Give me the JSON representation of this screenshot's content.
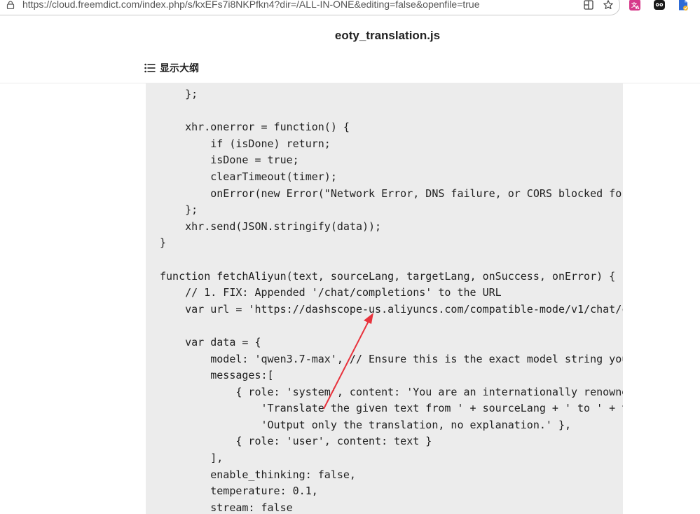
{
  "browser": {
    "url": "https://cloud.freemdict.com/index.php/s/kxEFs7i8NKPfkn4?dir=/ALL-IN-ONE&editing=false&openfile=true",
    "icons": [
      "lock-icon",
      "split-view-icon",
      "favorite-star-icon",
      "translate-extension-icon",
      "ghost-extension-icon",
      "bookmark-extension-icon"
    ],
    "accent_colors": {
      "translate": "#d63a8a",
      "bookmark": "#2e6bd6",
      "arrow": "#e8323c"
    }
  },
  "header": {
    "file_title": "eoty_translation.js",
    "outline_label": "显示大纲"
  },
  "code": {
    "lines": [
      "    };",
      "",
      "    xhr.onerror = function() {",
      "        if (isDone) return;",
      "        isDone = true;",
      "        clearTimeout(timer);",
      "        onError(new Error(\"Network Error, DNS failure, or CORS blocked fo",
      "    };",
      "    xhr.send(JSON.stringify(data));",
      "}",
      "",
      "function fetchAliyun(text, sourceLang, targetLang, onSuccess, onError) {",
      "    // 1. FIX: Appended '/chat/completions' to the URL",
      "    var url = 'https://dashscope-us.aliyuncs.com/compatible-mode/v1/chat/c",
      "",
      "    var data = {",
      "        model: 'qwen3.7-max', // Ensure this is the exact model string you",
      "        messages:[",
      "            { role: 'system', content: 'You are an internationally renowne",
      "                'Translate the given text from ' + sourceLang + ' to ' + t",
      "                'Output only the translation, no explanation.' },",
      "            { role: 'user', content: text }",
      "        ],",
      "        enable_thinking: false,",
      "        temperature: 0.1,",
      "        stream: false"
    ]
  }
}
